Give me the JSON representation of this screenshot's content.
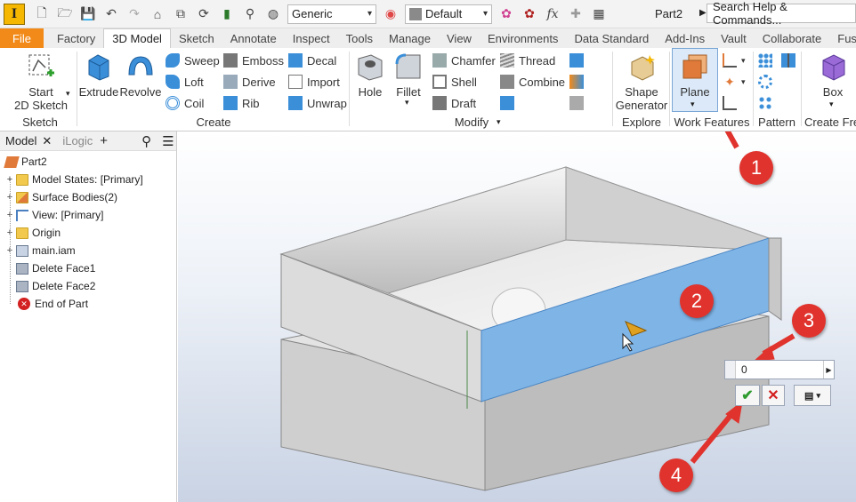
{
  "qat": {
    "logo": "I",
    "material": "Generic",
    "appearance": "Default",
    "fx": "fx",
    "doc_title": "Part2",
    "search_label": "Search Help & Commands..."
  },
  "tabs": [
    "File",
    "Factory",
    "3D Model",
    "Sketch",
    "Annotate",
    "Inspect",
    "Tools",
    "Manage",
    "View",
    "Environments",
    "Data Standard",
    "Add-Ins",
    "Vault",
    "Collaborate",
    "Fusion"
  ],
  "ribbon": {
    "start_sketch": "Start\n2D Sketch",
    "extrude": "Extrude",
    "revolve": "Revolve",
    "sweep": "Sweep",
    "emboss": "Emboss",
    "decal": "Decal",
    "loft": "Loft",
    "derive": "Derive",
    "import": "Import",
    "coil": "Coil",
    "rib": "Rib",
    "unwrap": "Unwrap",
    "hole": "Hole",
    "fillet": "Fillet",
    "chamfer": "Chamfer",
    "thread": "Thread",
    "shell": "Shell",
    "combine": "Combine",
    "draft": "Draft",
    "shape_generator": "Shape\nGenerator",
    "plane": "Plane",
    "box": "Box",
    "panels": {
      "sketch": "Sketch",
      "create": "Create",
      "modify": "Modify",
      "explore": "Explore",
      "work_features": "Work Features",
      "pattern": "Pattern",
      "create_freeform": "Create Free"
    }
  },
  "browser": {
    "tab_model": "Model",
    "tab_ilogic": "iLogic",
    "items": [
      {
        "label": "Part2"
      },
      {
        "label": "Model States: [Primary]"
      },
      {
        "label": "Surface Bodies(2)"
      },
      {
        "label": "View: [Primary]"
      },
      {
        "label": "Origin"
      },
      {
        "label": "main.iam"
      },
      {
        "label": "Delete Face1"
      },
      {
        "label": "Delete Face2"
      },
      {
        "label": "End of Part"
      }
    ]
  },
  "mini_toolbar": {
    "value": "0"
  },
  "callouts": [
    "1",
    "2",
    "3",
    "4"
  ],
  "colors": {
    "file_tab": "#f28a19",
    "callout": "#e0332d",
    "face_highlight": "#7fb4e6",
    "ok": "#2e9b2e",
    "cancel": "#d32020"
  }
}
